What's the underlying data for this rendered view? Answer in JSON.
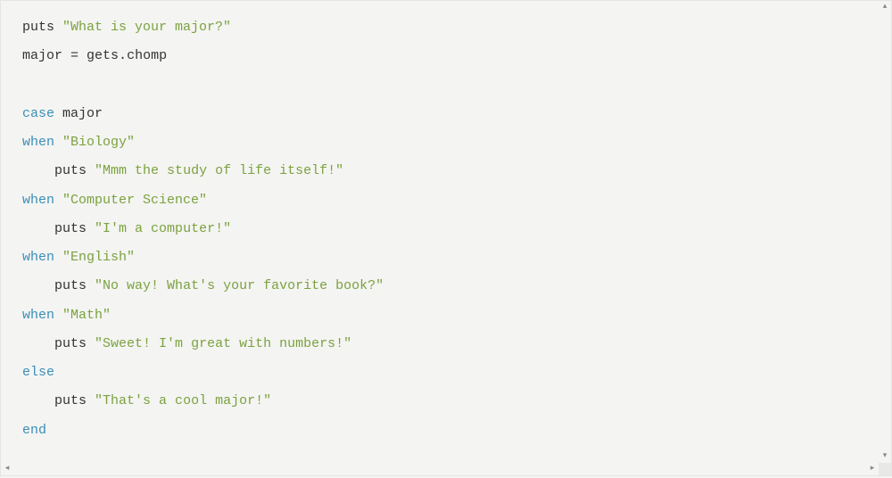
{
  "code": {
    "lines": [
      [
        {
          "text": "puts",
          "cls": "t-default"
        },
        {
          "text": " ",
          "cls": "t-default"
        },
        {
          "text": "\"What is your major?\"",
          "cls": "t-string"
        }
      ],
      [
        {
          "text": "major",
          "cls": "t-ident"
        },
        {
          "text": " = ",
          "cls": "t-op"
        },
        {
          "text": "gets",
          "cls": "t-default"
        },
        {
          "text": ".",
          "cls": "t-op"
        },
        {
          "text": "chomp",
          "cls": "t-method"
        }
      ],
      [],
      [
        {
          "text": "case",
          "cls": "t-keyword"
        },
        {
          "text": " ",
          "cls": "t-default"
        },
        {
          "text": "major",
          "cls": "t-ident"
        }
      ],
      [
        {
          "text": "when",
          "cls": "t-keyword"
        },
        {
          "text": " ",
          "cls": "t-default"
        },
        {
          "text": "\"Biology\"",
          "cls": "t-string"
        }
      ],
      [
        {
          "text": "    ",
          "cls": "t-default"
        },
        {
          "text": "puts",
          "cls": "t-default"
        },
        {
          "text": " ",
          "cls": "t-default"
        },
        {
          "text": "\"Mmm the study of life itself!\"",
          "cls": "t-string"
        }
      ],
      [
        {
          "text": "when",
          "cls": "t-keyword"
        },
        {
          "text": " ",
          "cls": "t-default"
        },
        {
          "text": "\"Computer Science\"",
          "cls": "t-string"
        }
      ],
      [
        {
          "text": "    ",
          "cls": "t-default"
        },
        {
          "text": "puts",
          "cls": "t-default"
        },
        {
          "text": " ",
          "cls": "t-default"
        },
        {
          "text": "\"I'm a computer!\"",
          "cls": "t-string"
        }
      ],
      [
        {
          "text": "when",
          "cls": "t-keyword"
        },
        {
          "text": " ",
          "cls": "t-default"
        },
        {
          "text": "\"English\"",
          "cls": "t-string"
        }
      ],
      [
        {
          "text": "    ",
          "cls": "t-default"
        },
        {
          "text": "puts",
          "cls": "t-default"
        },
        {
          "text": " ",
          "cls": "t-default"
        },
        {
          "text": "\"No way! What's your favorite book?\"",
          "cls": "t-string"
        }
      ],
      [
        {
          "text": "when",
          "cls": "t-keyword"
        },
        {
          "text": " ",
          "cls": "t-default"
        },
        {
          "text": "\"Math\"",
          "cls": "t-string"
        }
      ],
      [
        {
          "text": "    ",
          "cls": "t-default"
        },
        {
          "text": "puts",
          "cls": "t-default"
        },
        {
          "text": " ",
          "cls": "t-default"
        },
        {
          "text": "\"Sweet! I'm great with numbers!\"",
          "cls": "t-string"
        }
      ],
      [
        {
          "text": "else",
          "cls": "t-keyword"
        }
      ],
      [
        {
          "text": "    ",
          "cls": "t-default"
        },
        {
          "text": "puts",
          "cls": "t-default"
        },
        {
          "text": " ",
          "cls": "t-default"
        },
        {
          "text": "\"That's a cool major!\"",
          "cls": "t-string"
        }
      ],
      [
        {
          "text": "end",
          "cls": "t-keyword"
        }
      ]
    ]
  },
  "scroll": {
    "arrow_up": "▴",
    "arrow_down": "▾",
    "arrow_left": "◂",
    "arrow_right": "▸"
  }
}
